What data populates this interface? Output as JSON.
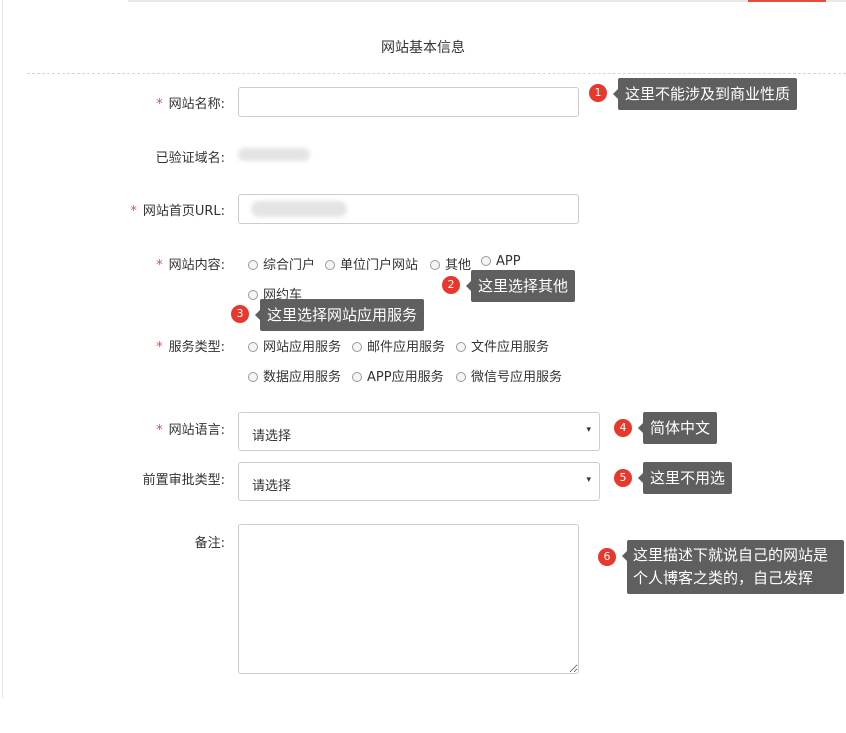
{
  "form": {
    "title": "网站基本信息",
    "required_mark": "*",
    "fields": {
      "site_name": {
        "label": "网站名称:",
        "value": ""
      },
      "verified_domain": {
        "label": "已验证域名:"
      },
      "homepage_url": {
        "label": "网站首页URL:",
        "value": ""
      },
      "site_content": {
        "label": "网站内容:",
        "options": [
          "综合门户",
          "单位门户网站",
          "其他",
          "APP",
          "网约车"
        ]
      },
      "service_type": {
        "label": "服务类型:",
        "options": [
          "网站应用服务",
          "邮件应用服务",
          "文件应用服务",
          "数据应用服务",
          "APP应用服务",
          "微信号应用服务"
        ]
      },
      "site_language": {
        "label": "网站语言:",
        "selected": "请选择"
      },
      "pre_approval_type": {
        "label": "前置审批类型:",
        "selected": "请选择"
      },
      "remarks": {
        "label": "备注:",
        "value": ""
      }
    }
  },
  "annotations": [
    {
      "num": "1",
      "text": "这里不能涉及到商业性质"
    },
    {
      "num": "2",
      "text": "这里选择其他"
    },
    {
      "num": "3",
      "text": "这里选择网站应用服务"
    },
    {
      "num": "4",
      "text": "简体中文"
    },
    {
      "num": "5",
      "text": "这里不用选"
    },
    {
      "num": "6",
      "text": "这里描述下就说自己的网站是个人博客之类的，自己发挥"
    }
  ],
  "colors": {
    "required": "#e84a3c",
    "badge": "#e8372c",
    "tooltip_bg": "#5f5f5f"
  },
  "icons": {
    "select_arrow": "▾"
  }
}
